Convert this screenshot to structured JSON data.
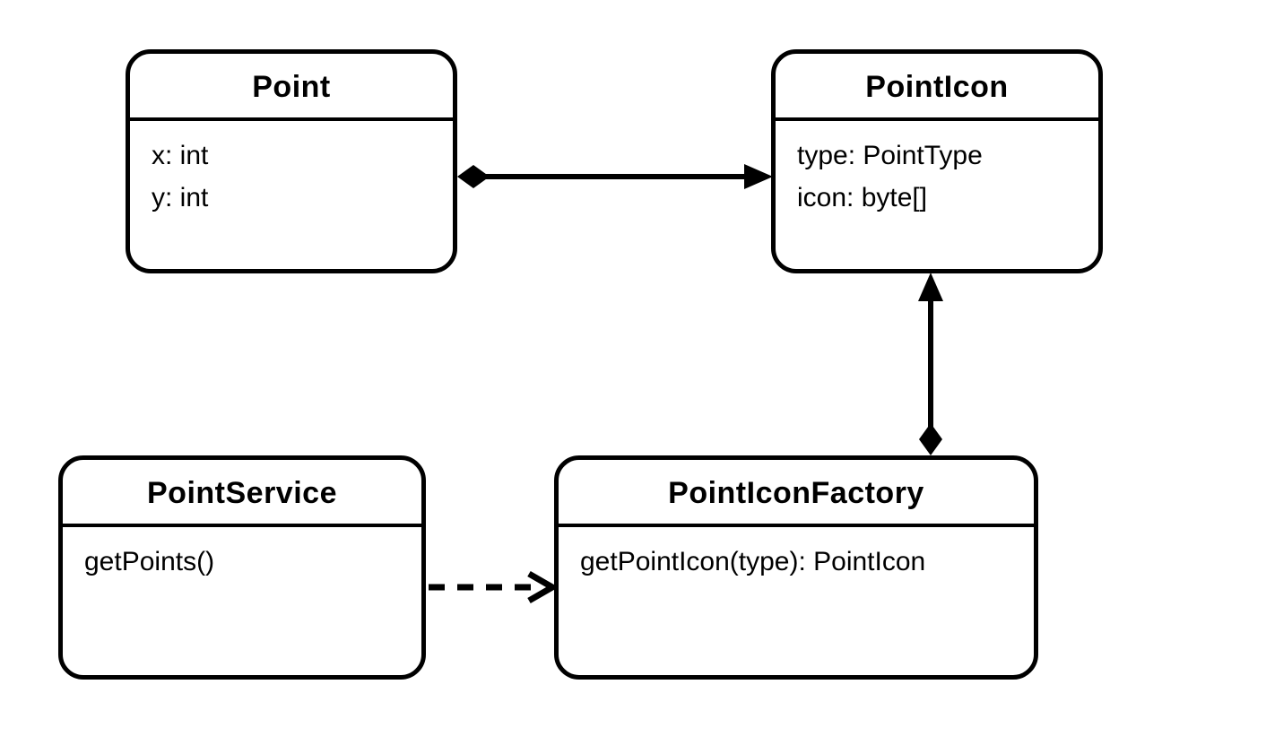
{
  "classes": {
    "point": {
      "name": "Point",
      "attributes": [
        "x: int",
        "y: int"
      ]
    },
    "pointIcon": {
      "name": "PointIcon",
      "attributes": [
        "type: PointType",
        "icon: byte[]"
      ]
    },
    "pointService": {
      "name": "PointService",
      "operations": [
        "getPoints()"
      ]
    },
    "pointIconFactory": {
      "name": "PointIconFactory",
      "operations": [
        "getPointIcon(type): PointIcon"
      ]
    }
  },
  "relationships": [
    {
      "from": "Point",
      "to": "PointIcon",
      "type": "composition",
      "style": "solid-arrow-diamond-tail"
    },
    {
      "from": "PointIconFactory",
      "to": "PointIcon",
      "type": "composition",
      "style": "solid-arrow-diamond-tail"
    },
    {
      "from": "PointService",
      "to": "PointIconFactory",
      "type": "dependency",
      "style": "dashed-open-arrow"
    }
  ]
}
